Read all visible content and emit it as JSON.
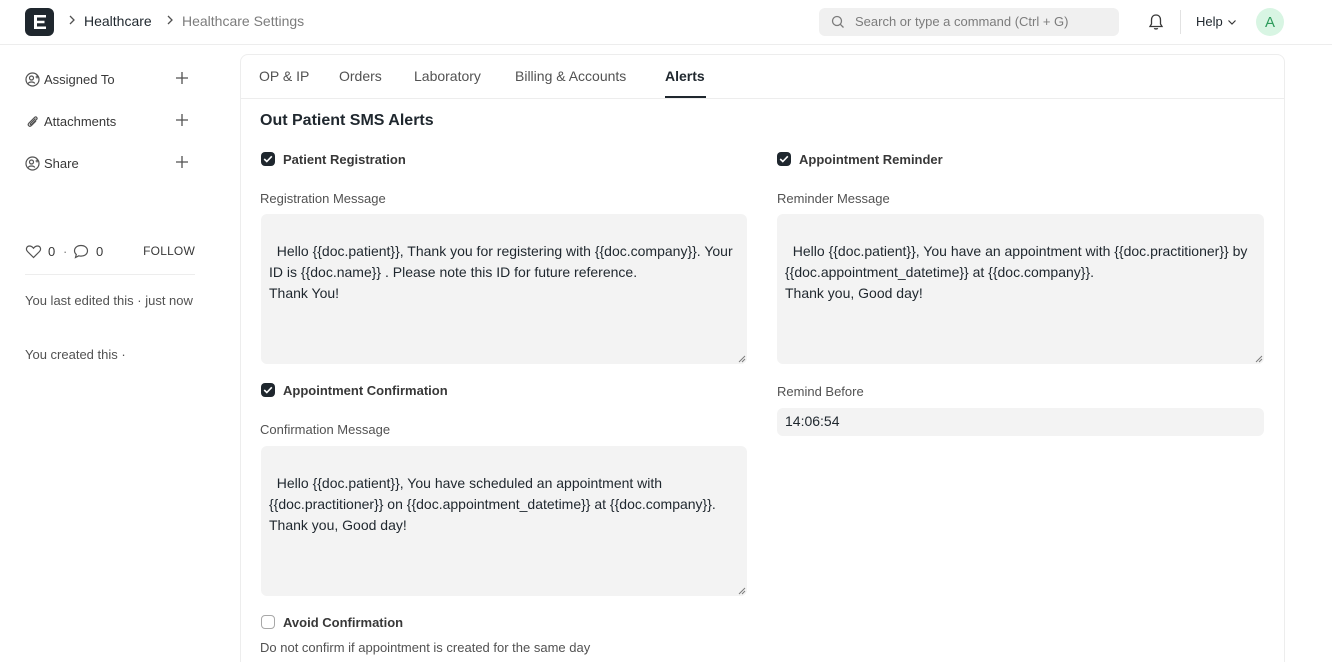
{
  "breadcrumbs": [
    "Healthcare",
    "Healthcare Settings"
  ],
  "search": {
    "placeholder": "Search or type a command (Ctrl + G)"
  },
  "navbar": {
    "help_label": "Help",
    "avatar_initial": "A"
  },
  "sidebar": {
    "items": [
      {
        "label": "Assigned To",
        "icon": "assign-icon"
      },
      {
        "label": "Attachments",
        "icon": "paperclip-icon"
      },
      {
        "label": "Share",
        "icon": "share-icon"
      }
    ],
    "likes": "0",
    "comments": "0",
    "separator": "·",
    "follow_label": "FOLLOW",
    "last_edited": "You last edited this · just now",
    "created": "You created this ·"
  },
  "tabs": [
    "OP & IP",
    "Orders",
    "Laboratory",
    "Billing & Accounts",
    "Alerts"
  ],
  "active_tab": "Alerts",
  "section": {
    "title": "Out Patient SMS Alerts",
    "patient_registration": {
      "label": "Patient Registration",
      "checked": true
    },
    "registration_message": {
      "label": "Registration Message",
      "value": "Hello {{doc.patient}}, Thank you for registering with {{doc.company}}. Your ID is {{doc.name}} . Please note this ID for future reference.\nThank You!"
    },
    "appointment_confirmation": {
      "label": "Appointment Confirmation",
      "checked": true
    },
    "confirmation_message": {
      "label": "Confirmation Message",
      "value": "Hello {{doc.patient}}, You have scheduled an appointment with {{doc.practitioner}} on {{doc.appointment_datetime}} at {{doc.company}}.\nThank you, Good day!"
    },
    "avoid_confirmation": {
      "label": "Avoid Confirmation",
      "checked": false,
      "description": "Do not confirm if appointment is created for the same day"
    },
    "appointment_reminder": {
      "label": "Appointment Reminder",
      "checked": true
    },
    "reminder_message": {
      "label": "Reminder Message",
      "value": "Hello {{doc.patient}}, You have an appointment with {{doc.practitioner}} by {{doc.appointment_datetime}} at {{doc.company}}.\nThank you, Good day!"
    },
    "remind_before": {
      "label": "Remind Before",
      "value": "14:06:54"
    }
  },
  "colors": {
    "accent": "#1f272e",
    "field_bg": "#f3f3f3",
    "avatar_bg": "#d8f5e3",
    "avatar_text": "#2c9b5b"
  }
}
